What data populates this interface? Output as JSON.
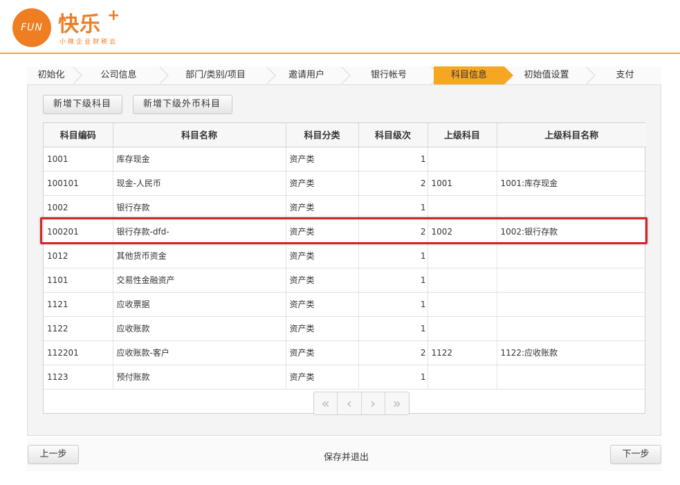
{
  "brand": {
    "logo_text": "FUN",
    "title": "快乐",
    "plus": "+",
    "subtitle": "小微企业财税云",
    "accent": "#ef7d22"
  },
  "steps": [
    {
      "label": "初始化"
    },
    {
      "label": "公司信息"
    },
    {
      "label": "部门/类别/项目"
    },
    {
      "label": "邀请用户"
    },
    {
      "label": "银行帐号"
    },
    {
      "label": "科目信息",
      "active": true
    },
    {
      "label": "初始值设置"
    },
    {
      "label": "支付"
    }
  ],
  "toolbar": {
    "add_sub_label": "新增下级科目",
    "add_sub_fx_label": "新增下级外币科目"
  },
  "table": {
    "headers": [
      "科目编码",
      "科目名称",
      "科目分类",
      "科目级次",
      "上级科目",
      "上级科目名称"
    ],
    "rows": [
      [
        "1001",
        "库存现金",
        "资产类",
        "1",
        "",
        ""
      ],
      [
        "100101",
        "现金-人民币",
        "资产类",
        "2",
        "1001",
        "1001:库存现金"
      ],
      [
        "1002",
        "银行存款",
        "资产类",
        "1",
        "",
        ""
      ],
      [
        "100201",
        "银行存款-dfd-",
        "资产类",
        "2",
        "1002",
        "1002:银行存款"
      ],
      [
        "1012",
        "其他货币资金",
        "资产类",
        "1",
        "",
        ""
      ],
      [
        "1101",
        "交易性金融资产",
        "资产类",
        "1",
        "",
        ""
      ],
      [
        "1121",
        "应收票据",
        "资产类",
        "1",
        "",
        ""
      ],
      [
        "1122",
        "应收账款",
        "资产类",
        "1",
        "",
        ""
      ],
      [
        "112201",
        "应收账款-客户",
        "资产类",
        "2",
        "1122",
        "1122:应收账款"
      ],
      [
        "1123",
        "预付账款",
        "资产类",
        "1",
        "",
        ""
      ]
    ]
  },
  "pager": {
    "first": "«",
    "prev": "‹",
    "next": "›",
    "last": "»"
  },
  "footer": {
    "prev_label": "上一步",
    "save_label": "保存并退出",
    "next_label": "下一步"
  },
  "colors": {
    "active_step": "#f5a623",
    "highlight_border": "#d42424",
    "header_line": "#f5a13a"
  }
}
